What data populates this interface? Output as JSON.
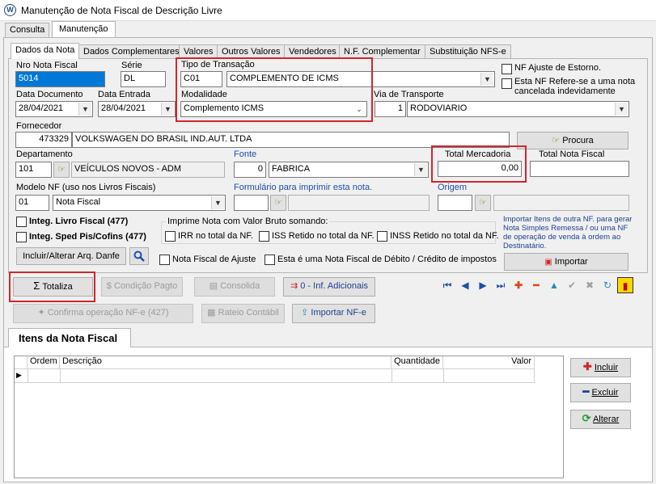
{
  "window": {
    "title": "Manutenção de Nota Fiscal de Descrição Livre"
  },
  "top_tabs": [
    "Consulta",
    "Manutenção"
  ],
  "sub_tabs": [
    "Dados da Nota",
    "Dados Complementares",
    "Valores",
    "Outros Valores",
    "Vendedores",
    "N.F. Complementar",
    "Substituição NFS-e"
  ],
  "form": {
    "nro_label": "Nro Nota Fiscal",
    "nro_value": "5014",
    "serie_label": "Série",
    "serie_value": "DL",
    "tipo_label": "Tipo de Transação",
    "tipo_code": "C01",
    "tipo_desc": "COMPLEMENTO DE ICMS",
    "nf_ajuste_estorno": "NF Ajuste de Estorno.",
    "nf_refere_cancelada": "Esta NF Refere-se a uma nota cancelada indevidamente",
    "data_doc_label": "Data Documento",
    "data_doc_value": "28/04/2021",
    "data_entrada_label": "Data Entrada",
    "data_entrada_value": "28/04/2021",
    "modalidade_label": "Modalidade",
    "modalidade_value": "Complemento ICMS",
    "via_label": "Via de Transporte",
    "via_code": "1",
    "via_desc": "RODOVIARIO",
    "fornecedor_label": "Fornecedor",
    "fornecedor_code": "473329",
    "fornecedor_name": "VOLKSWAGEN DO BRASIL IND.AUT. LTDA",
    "procura_label": "Procura",
    "departamento_label": "Departamento",
    "departamento_code": "101",
    "departamento_name": "VEÍCULOS NOVOS - ADM",
    "fonte_label": "Fonte",
    "fonte_code": "0",
    "fonte_desc": "FABRICA",
    "total_mercadoria_label": "Total Mercadoria",
    "total_mercadoria_value": "0,00",
    "total_nota_label": "Total Nota Fiscal",
    "total_nota_value": "",
    "modelo_label": "Modelo NF (uso nos Livros Fiscais)",
    "modelo_code": "01",
    "modelo_desc": "Nota Fiscal",
    "formulario_label": "Formulário para imprimir esta nota.",
    "origem_label": "Origem",
    "integ_livro": "Integ. Livro Fiscal (477)",
    "integ_sped": "Integ. Sped Pis/Cofins (477)",
    "imprime_label": "Imprime Nota com Valor Bruto somando:",
    "irr_label": "IRR no total da NF.",
    "iss_label": "ISS Retido no total da NF.",
    "inss_label": "INSS Retido no total da NF.",
    "importar_info": "Importar Itens de outra NF. para gerar Nota Simples Remessa / ou uma NF de operação de venda à ordem ao Destinatário.",
    "importar_btn": "Importar",
    "incluir_arq": "Incluir/Alterar Arq. Danfe",
    "nf_ajuste": "Nota Fiscal de Ajuste",
    "nf_debito": "Esta é uma Nota Fiscal de Débito / Crédito de impostos"
  },
  "actions": {
    "totaliza": "Totaliza",
    "condicao": "Condição Pagto",
    "consolida": "Consolida",
    "inf_adicionais": "0 - Inf. Adicionais",
    "confirma": "Confirma operação NF-e (427)",
    "rateio": "Rateio Contábil",
    "importar_nfe": "Importar NF-e"
  },
  "items": {
    "tab_label": "Itens da Nota Fiscal",
    "columns": [
      "Ordem",
      "Descrição",
      "Quantidade",
      "Valor"
    ],
    "rows": [],
    "incluir": "Incluir",
    "excluir": "Excluir",
    "alterar": "Alterar"
  },
  "colors": {
    "highlight": "#d0272e",
    "selection": "#0078d7",
    "link_blue": "#1f4ea8"
  }
}
